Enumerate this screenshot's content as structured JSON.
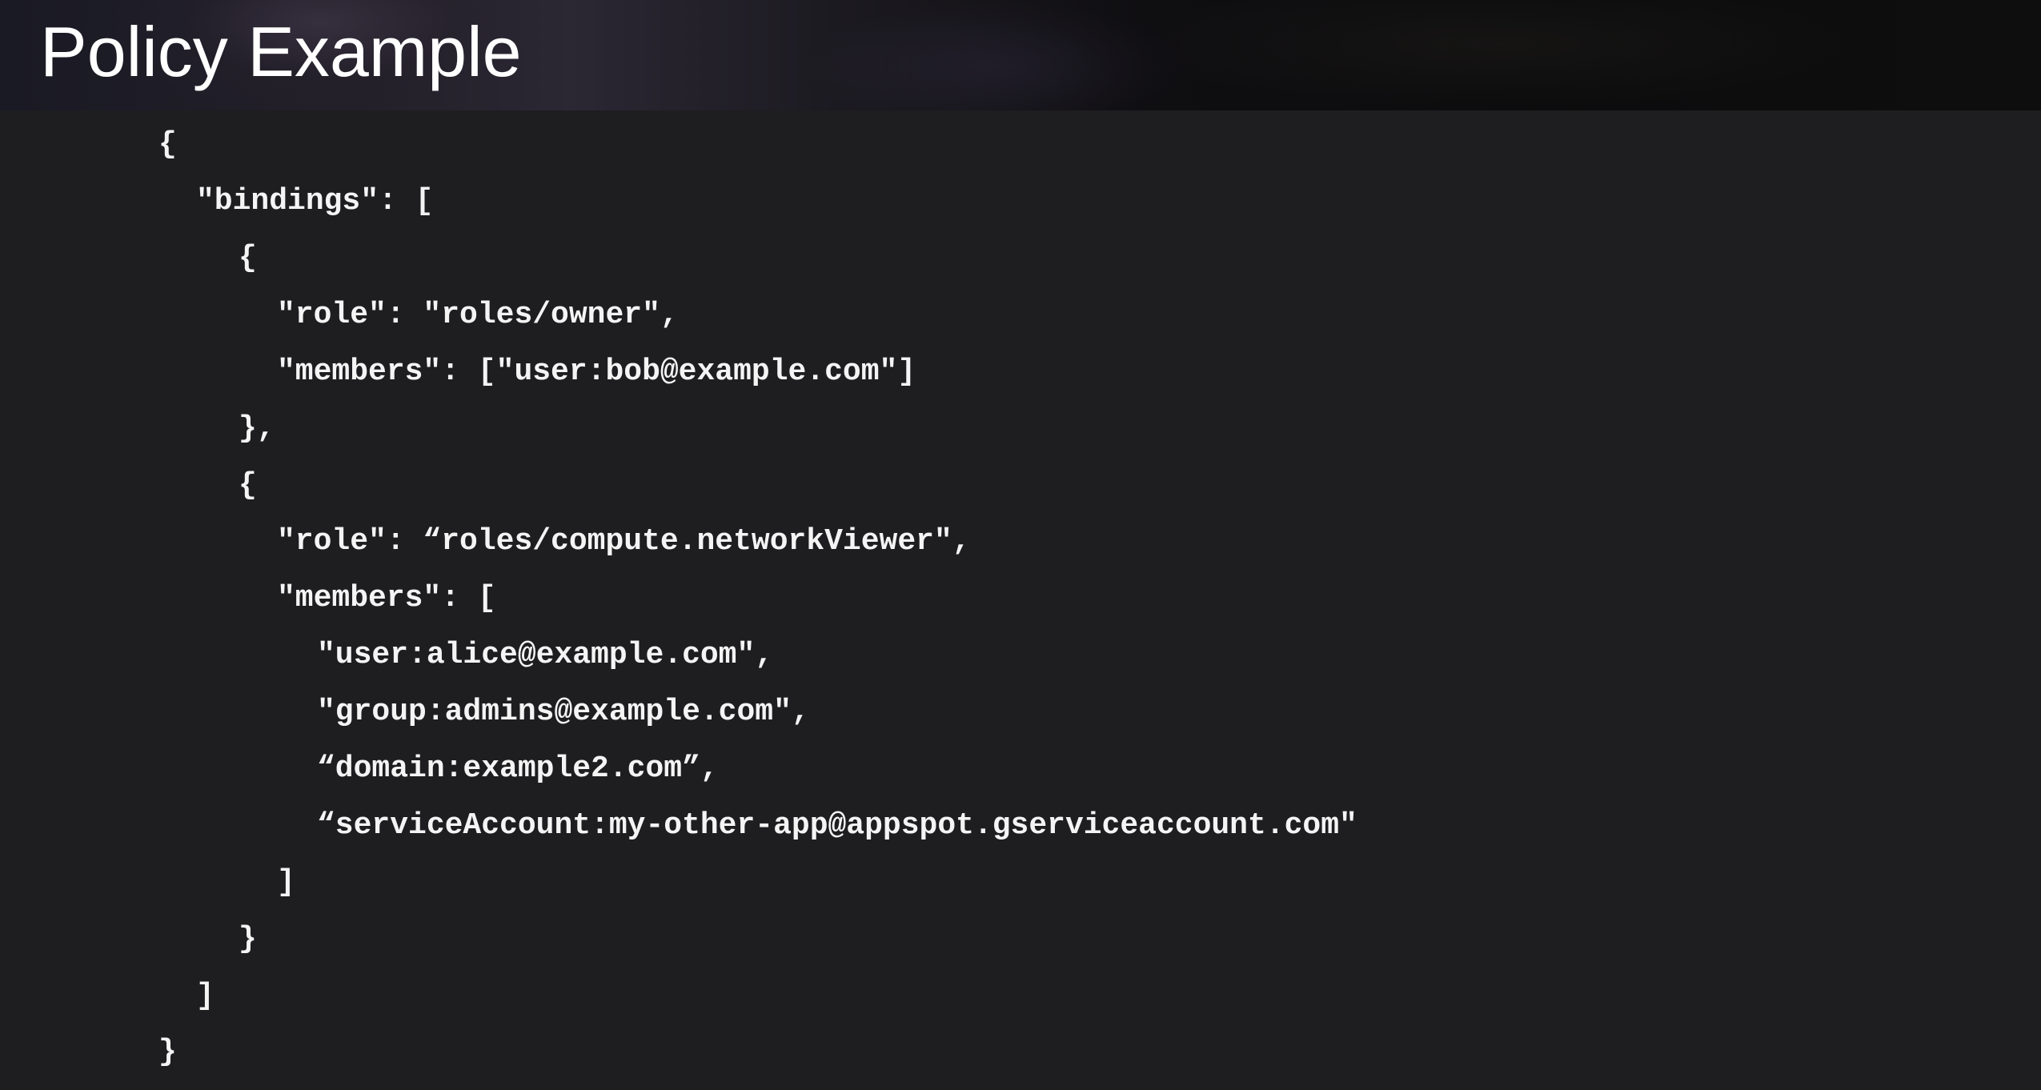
{
  "slide": {
    "title": "Policy Example"
  },
  "code": {
    "lines": [
      "{",
      "\"bindings\": [",
      "{",
      "\"role\": \"roles/owner\",",
      "\"members\": [\"user:bob@example.com\"]",
      "},",
      "{",
      "\"role\": “roles/compute.networkViewer\",",
      "\"members\": [",
      "\"user:alice@example.com\",",
      "\"group:admins@example.com\",",
      "“domain:example2.com”,",
      "“serviceAccount:my-other-app@appspot.gserviceaccount.com\"",
      "]",
      "}",
      "]",
      "}"
    ]
  }
}
